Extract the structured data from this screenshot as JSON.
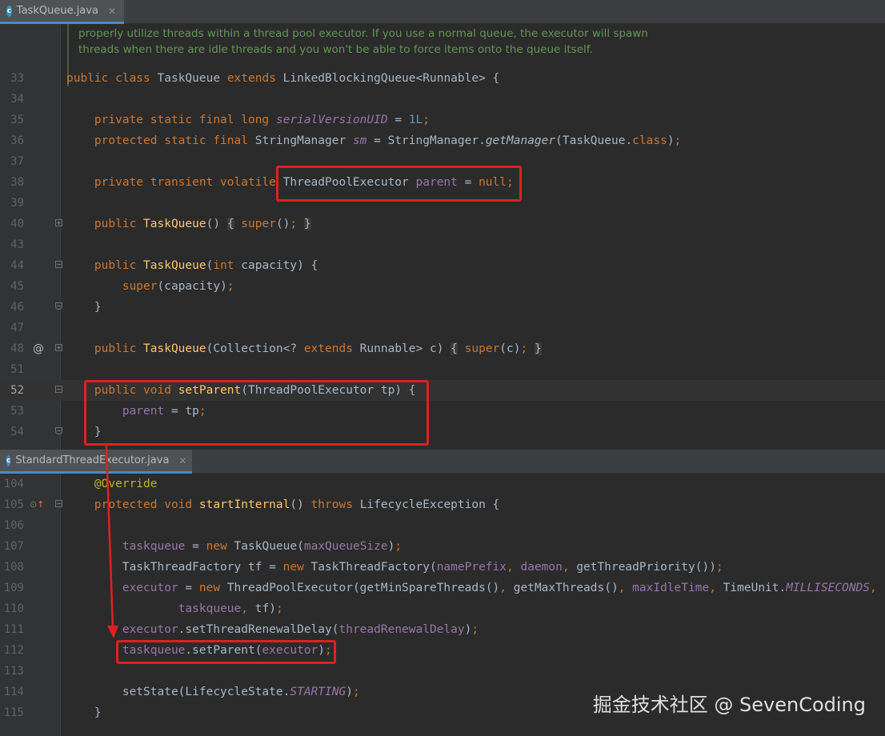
{
  "tabs": {
    "top": {
      "label": "TaskQueue.java",
      "icon": "c"
    },
    "bottom": {
      "label": "StandardThreadExecutor.java",
      "icon": "c"
    }
  },
  "doc_comment": [
    "properly utilize threads within a thread pool executor. If you use a normal queue, the executor will spawn",
    "threads when there are idle threads and you won't be able to force items onto the queue itself."
  ],
  "top_lines": [
    {
      "n": "33"
    },
    {
      "n": "34"
    },
    {
      "n": "35"
    },
    {
      "n": "36"
    },
    {
      "n": "37"
    },
    {
      "n": "38"
    },
    {
      "n": "39"
    },
    {
      "n": "40"
    },
    {
      "n": "43"
    },
    {
      "n": "44"
    },
    {
      "n": "45"
    },
    {
      "n": "46"
    },
    {
      "n": "47"
    },
    {
      "n": "48"
    },
    {
      "n": "51"
    },
    {
      "n": "52"
    },
    {
      "n": "53"
    },
    {
      "n": "54"
    }
  ],
  "bottom_lines": [
    {
      "n": "104"
    },
    {
      "n": "105"
    },
    {
      "n": "106"
    },
    {
      "n": "107"
    },
    {
      "n": "108"
    },
    {
      "n": "109"
    },
    {
      "n": "110"
    },
    {
      "n": "111"
    },
    {
      "n": "112"
    },
    {
      "n": "113"
    },
    {
      "n": "114"
    },
    {
      "n": "115"
    }
  ],
  "watermark": "掘金技术社区 @ SevenCoding",
  "colors": {
    "background": "#2b2b2b",
    "keyword": "#cc7832",
    "field": "#9876aa",
    "method": "#ffc66d",
    "number": "#6897bb",
    "annotation": "#bbb529",
    "comment": "#629755",
    "highlight_box": "#e02020"
  }
}
